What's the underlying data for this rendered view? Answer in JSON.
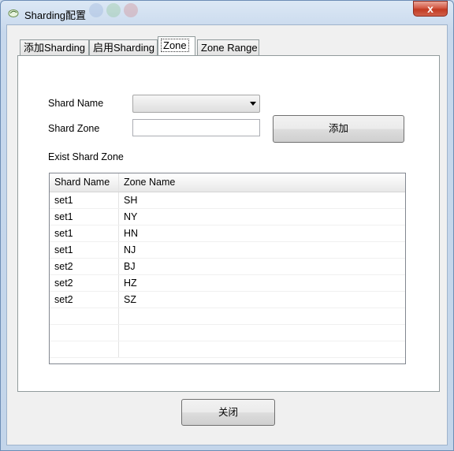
{
  "window": {
    "title": "Sharding配置",
    "close_glyph": "x"
  },
  "tabs": [
    {
      "label": "添加Sharding",
      "active": false
    },
    {
      "label": "启用Sharding",
      "active": false
    },
    {
      "label": "Zone",
      "active": true
    },
    {
      "label": "Zone Range",
      "active": false
    }
  ],
  "form": {
    "shard_name_label": "Shard Name",
    "shard_name_value": "",
    "shard_zone_label": "Shard Zone",
    "shard_zone_value": "",
    "add_button": "添加",
    "exist_label": "Exist Shard Zone"
  },
  "table": {
    "columns": [
      "Shard Name",
      "Zone Name"
    ],
    "rows": [
      [
        "set1",
        "SH"
      ],
      [
        "set1",
        "NY"
      ],
      [
        "set1",
        "HN"
      ],
      [
        "set1",
        "NJ"
      ],
      [
        "set2",
        "BJ"
      ],
      [
        "set2",
        "HZ"
      ],
      [
        "set2",
        "SZ"
      ]
    ]
  },
  "footer": {
    "close_button": "关闭"
  },
  "colors": {
    "window_frame": "#c7d8ec",
    "close_button": "#c23a22",
    "panel_bg": "#ffffff"
  }
}
